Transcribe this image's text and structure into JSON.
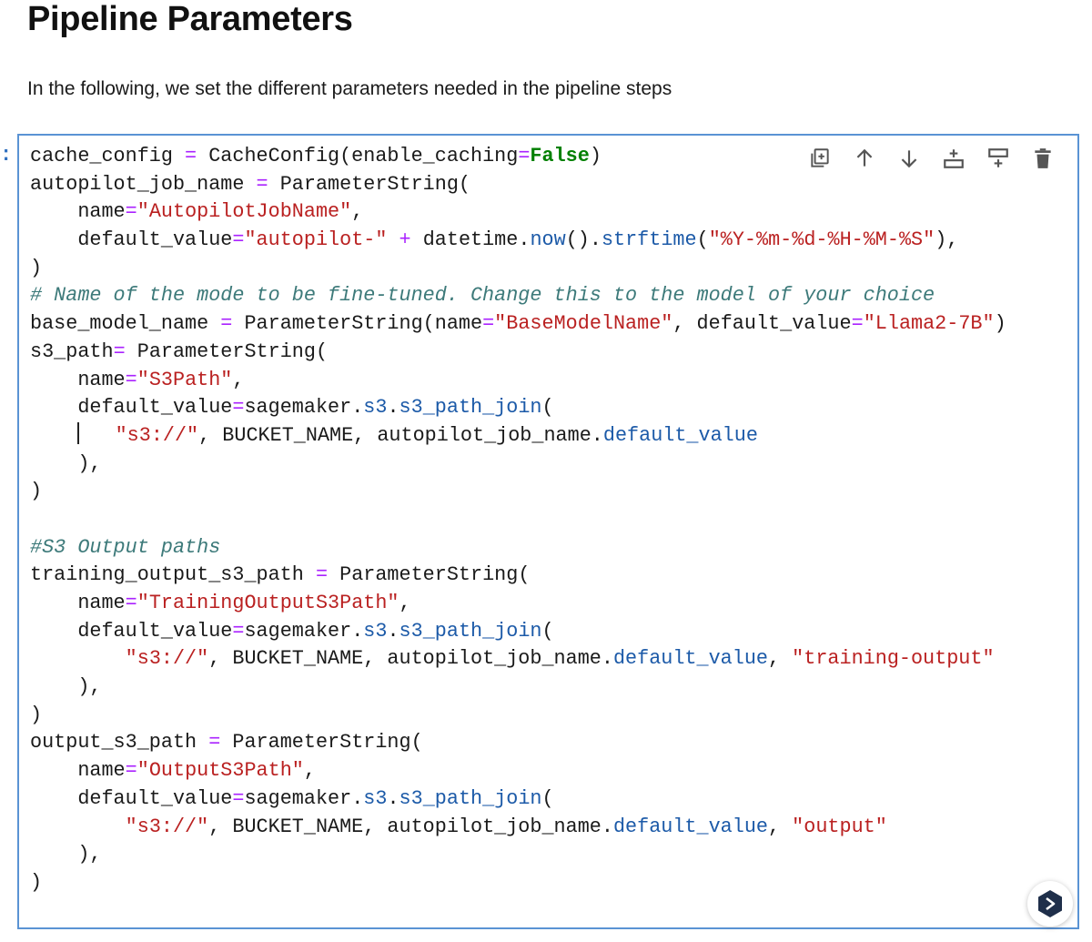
{
  "heading": "Pipeline Parameters",
  "intro_text": "In the following, we set the different parameters needed in the pipeline steps",
  "cell": {
    "prompt": ":",
    "toolbar": [
      {
        "name": "duplicate-cell",
        "icon": "duplicate-icon"
      },
      {
        "name": "move-cell-up",
        "icon": "arrow-up-icon"
      },
      {
        "name": "move-cell-down",
        "icon": "arrow-down-icon"
      },
      {
        "name": "insert-cell-above",
        "icon": "insert-above-icon"
      },
      {
        "name": "insert-cell-below",
        "icon": "insert-below-icon"
      },
      {
        "name": "delete-cell",
        "icon": "trash-icon"
      }
    ],
    "lines": [
      [
        [
          "t",
          "cache_config "
        ],
        [
          "op",
          "="
        ],
        [
          "t",
          " CacheConfig(enable_caching"
        ],
        [
          "op",
          "="
        ],
        [
          "kw",
          "False"
        ],
        [
          "t",
          ")"
        ]
      ],
      [
        [
          "t",
          "autopilot_job_name "
        ],
        [
          "op",
          "="
        ],
        [
          "t",
          " ParameterString("
        ]
      ],
      [
        [
          "t",
          "    name"
        ],
        [
          "op",
          "="
        ],
        [
          "str",
          "\"AutopilotJobName\""
        ],
        [
          "t",
          ","
        ]
      ],
      [
        [
          "t",
          "    default_value"
        ],
        [
          "op",
          "="
        ],
        [
          "str",
          "\"autopilot-\""
        ],
        [
          "t",
          " "
        ],
        [
          "op",
          "+"
        ],
        [
          "t",
          " datetime."
        ],
        [
          "attr",
          "now"
        ],
        [
          "t",
          "()."
        ],
        [
          "attr",
          "strftime"
        ],
        [
          "t",
          "("
        ],
        [
          "str",
          "\"%Y-%m-%d-%H-%M-%S\""
        ],
        [
          "t",
          "),"
        ]
      ],
      [
        [
          "t",
          ")"
        ]
      ],
      [
        [
          "com",
          "# Name of the mode to be fine-tuned. Change this to the model of your choice"
        ]
      ],
      [
        [
          "t",
          "base_model_name "
        ],
        [
          "op",
          "="
        ],
        [
          "t",
          " ParameterString(name"
        ],
        [
          "op",
          "="
        ],
        [
          "str",
          "\"BaseModelName\""
        ],
        [
          "t",
          ", default_value"
        ],
        [
          "op",
          "="
        ],
        [
          "str",
          "\"Llama2-7B\""
        ],
        [
          "t",
          ")"
        ]
      ],
      [
        [
          "t",
          "s3_path"
        ],
        [
          "op",
          "="
        ],
        [
          "t",
          " ParameterString("
        ]
      ],
      [
        [
          "t",
          "    name"
        ],
        [
          "op",
          "="
        ],
        [
          "str",
          "\"S3Path\""
        ],
        [
          "t",
          ","
        ]
      ],
      [
        [
          "t",
          "    default_value"
        ],
        [
          "op",
          "="
        ],
        [
          "t",
          "sagemaker."
        ],
        [
          "attr",
          "s3"
        ],
        [
          "t",
          "."
        ],
        [
          "attr",
          "s3_path_join"
        ],
        [
          "t",
          "("
        ]
      ],
      [
        [
          "t",
          "    "
        ],
        [
          "cursor",
          ""
        ],
        [
          "t",
          "   "
        ],
        [
          "str",
          "\"s3://\""
        ],
        [
          "t",
          ", BUCKET_NAME, autopilot_job_name."
        ],
        [
          "attr",
          "default_value"
        ]
      ],
      [
        [
          "t",
          "    ),"
        ]
      ],
      [
        [
          "t",
          ")"
        ]
      ],
      [],
      [
        [
          "com",
          "#S3 Output paths"
        ]
      ],
      [
        [
          "t",
          "training_output_s3_path "
        ],
        [
          "op",
          "="
        ],
        [
          "t",
          " ParameterString("
        ]
      ],
      [
        [
          "t",
          "    name"
        ],
        [
          "op",
          "="
        ],
        [
          "str",
          "\"TrainingOutputS3Path\""
        ],
        [
          "t",
          ","
        ]
      ],
      [
        [
          "t",
          "    default_value"
        ],
        [
          "op",
          "="
        ],
        [
          "t",
          "sagemaker."
        ],
        [
          "attr",
          "s3"
        ],
        [
          "t",
          "."
        ],
        [
          "attr",
          "s3_path_join"
        ],
        [
          "t",
          "("
        ]
      ],
      [
        [
          "t",
          "        "
        ],
        [
          "str",
          "\"s3://\""
        ],
        [
          "t",
          ", BUCKET_NAME, autopilot_job_name."
        ],
        [
          "attr",
          "default_value"
        ],
        [
          "t",
          ", "
        ],
        [
          "str",
          "\"training-output\""
        ]
      ],
      [
        [
          "t",
          "    ),"
        ]
      ],
      [
        [
          "t",
          ")"
        ]
      ],
      [
        [
          "t",
          "output_s3_path "
        ],
        [
          "op",
          "="
        ],
        [
          "t",
          " ParameterString("
        ]
      ],
      [
        [
          "t",
          "    name"
        ],
        [
          "op",
          "="
        ],
        [
          "str",
          "\"OutputS3Path\""
        ],
        [
          "t",
          ","
        ]
      ],
      [
        [
          "t",
          "    default_value"
        ],
        [
          "op",
          "="
        ],
        [
          "t",
          "sagemaker."
        ],
        [
          "attr",
          "s3"
        ],
        [
          "t",
          "."
        ],
        [
          "attr",
          "s3_path_join"
        ],
        [
          "t",
          "("
        ]
      ],
      [
        [
          "t",
          "        "
        ],
        [
          "str",
          "\"s3://\""
        ],
        [
          "t",
          ", BUCKET_NAME, autopilot_job_name."
        ],
        [
          "attr",
          "default_value"
        ],
        [
          "t",
          ", "
        ],
        [
          "str",
          "\"output\""
        ]
      ],
      [
        [
          "t",
          "    ),"
        ]
      ],
      [
        [
          "t",
          ")"
        ]
      ]
    ]
  },
  "assistant_badge": {
    "icon": "assistant-chevron-icon"
  },
  "colors": {
    "cell_border": "#5a93d4",
    "operator": "#aa22ff",
    "keyword": "#008000",
    "string": "#ba2121",
    "attribute": "#1c5aa8",
    "comment": "#3d7a7a"
  }
}
